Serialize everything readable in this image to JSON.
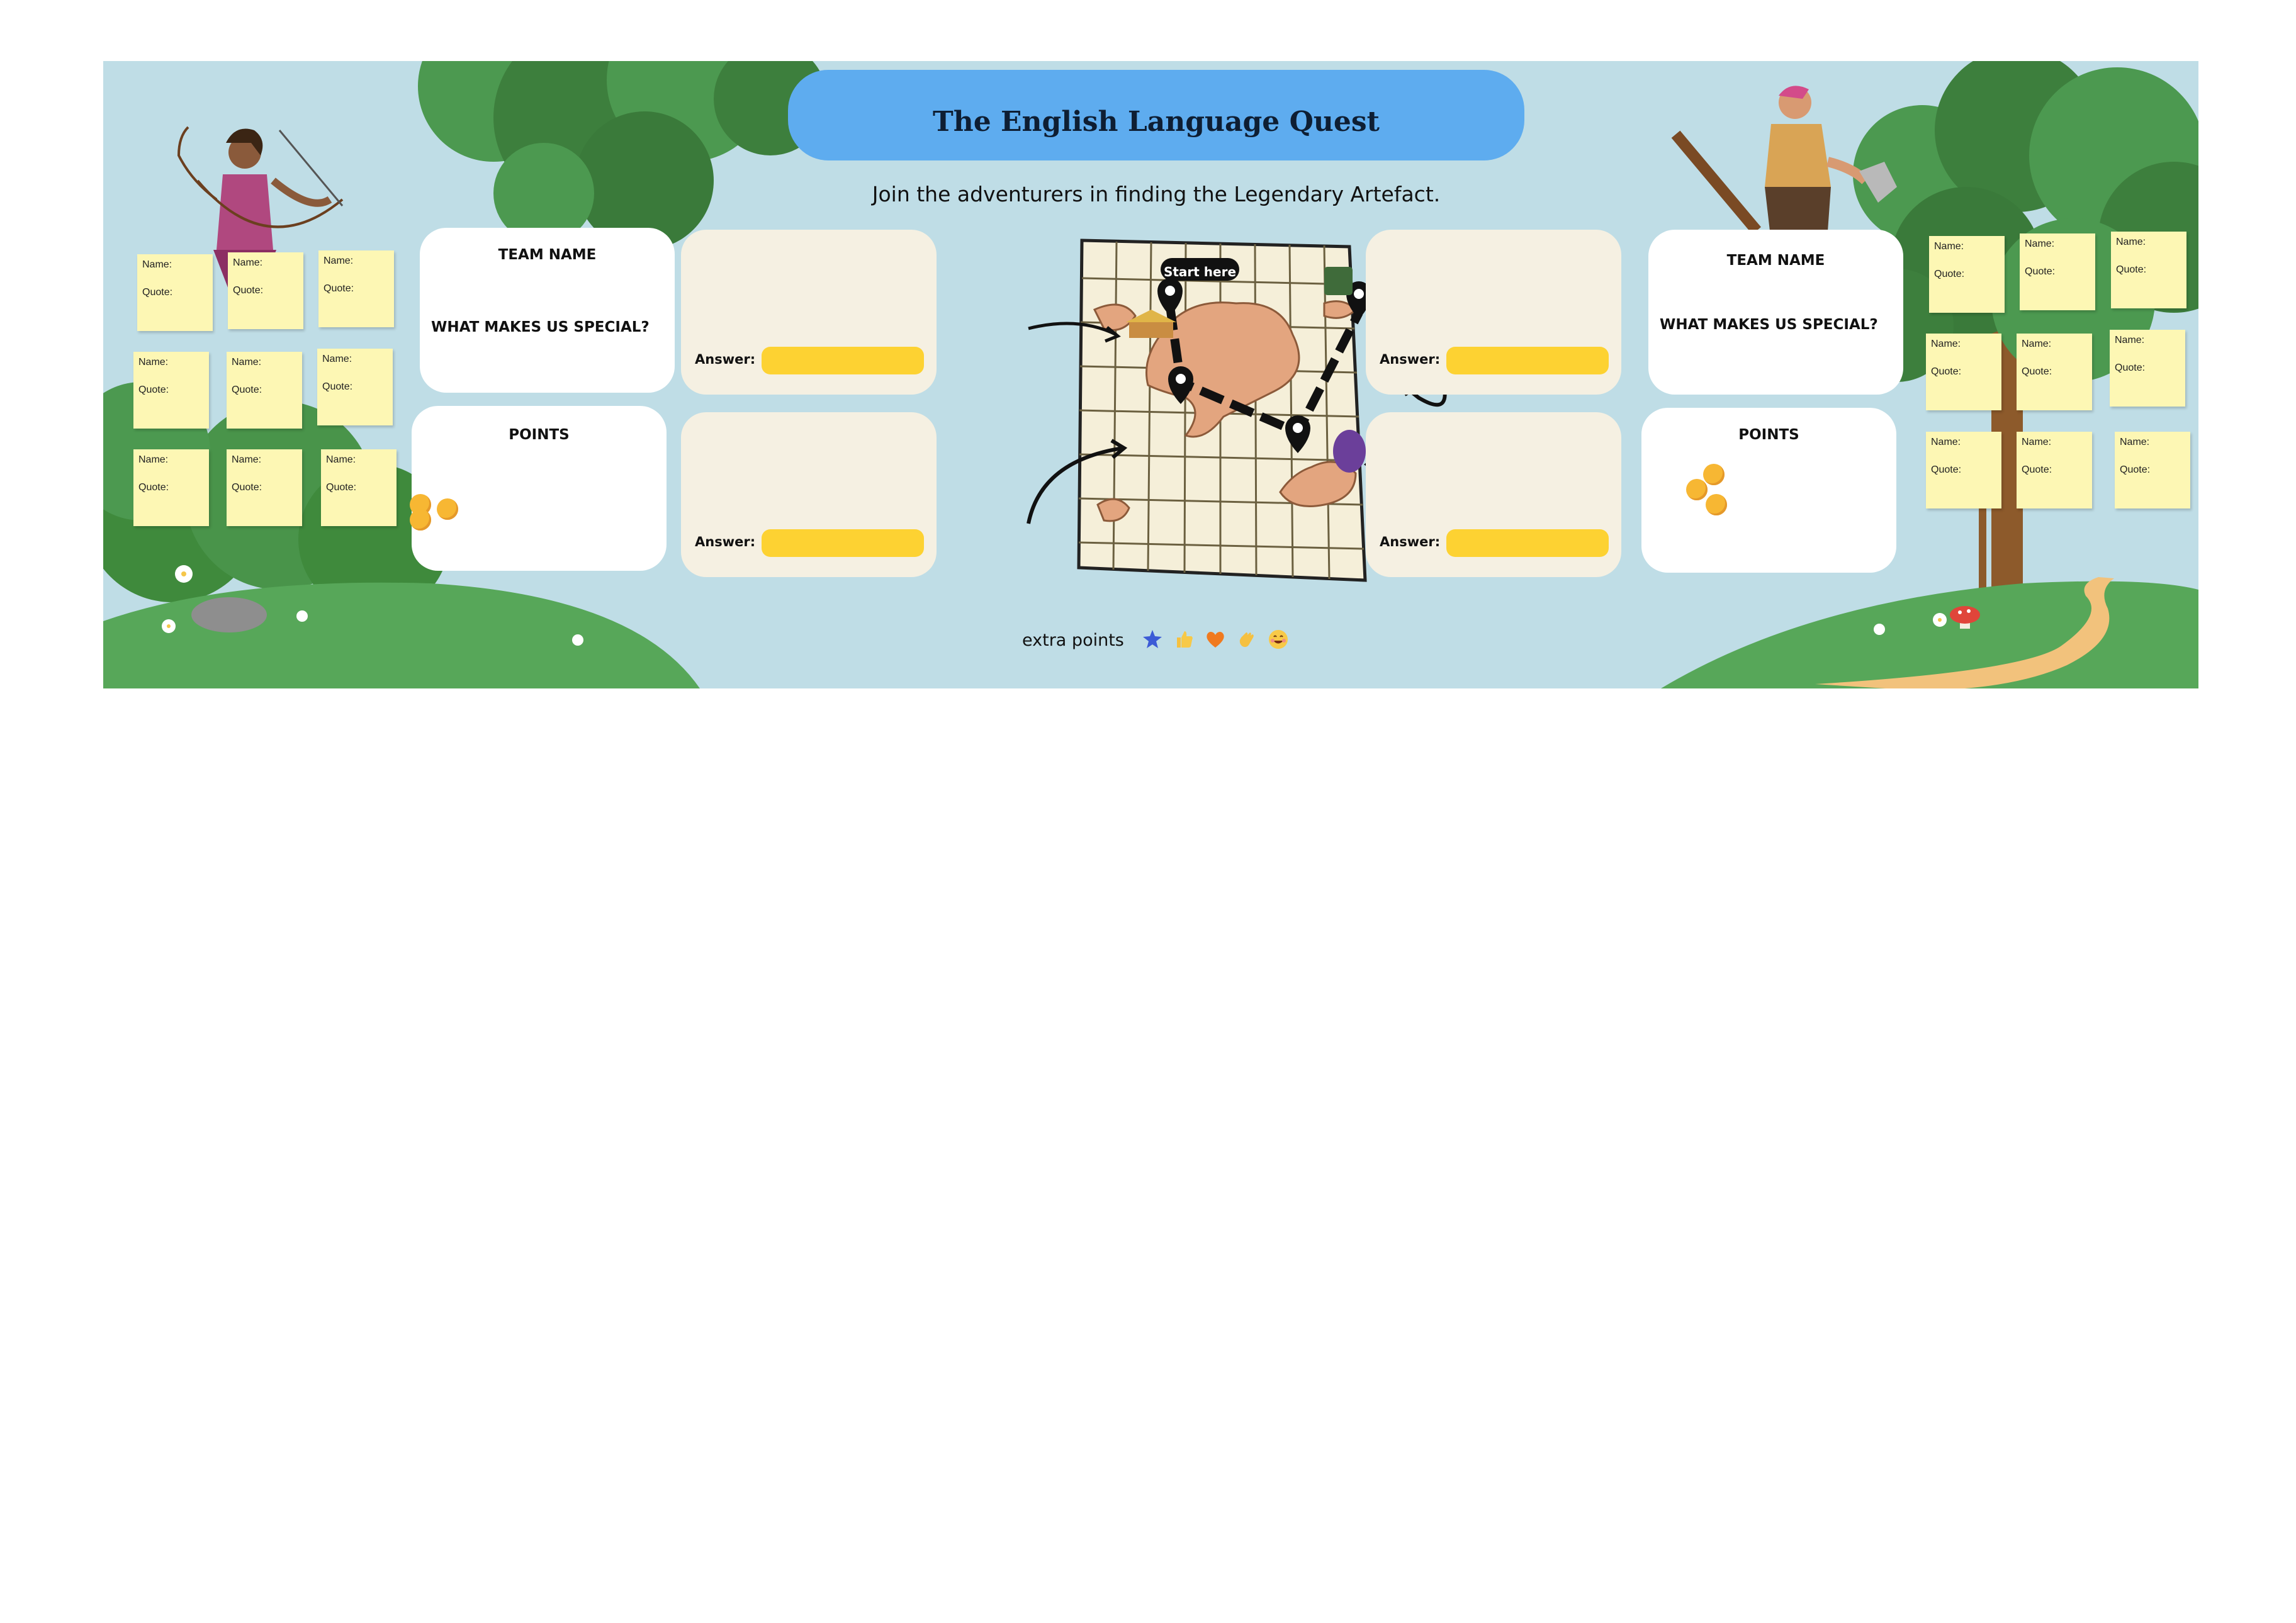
{
  "board": {
    "title": "The English Language Quest",
    "subtitle": "Join the adventurers in finding the Legendary Artefact.",
    "colors": {
      "banner": "#5eacef",
      "background": "#bfdde6",
      "answer_bar": "#fdd232",
      "sticky": "#fdf7b4"
    }
  },
  "left_team": {
    "team_name_label": "TEAM NAME",
    "special_label": "WHAT MAKES US SPECIAL?",
    "points_label": "POINTS"
  },
  "right_team": {
    "team_name_label": "TEAM NAME",
    "special_label": "WHAT MAKES US SPECIAL?",
    "points_label": "POINTS"
  },
  "questions": {
    "answer_label": "Answer:"
  },
  "map": {
    "start_label": "Start here"
  },
  "sticky_notes": {
    "name_label": "Name:",
    "quote_label": "Quote:"
  },
  "extra_points": {
    "label": "extra points",
    "reactions": [
      "star-icon",
      "thumbs-up-icon",
      "heart-icon",
      "clap-icon",
      "smile-icon"
    ]
  }
}
